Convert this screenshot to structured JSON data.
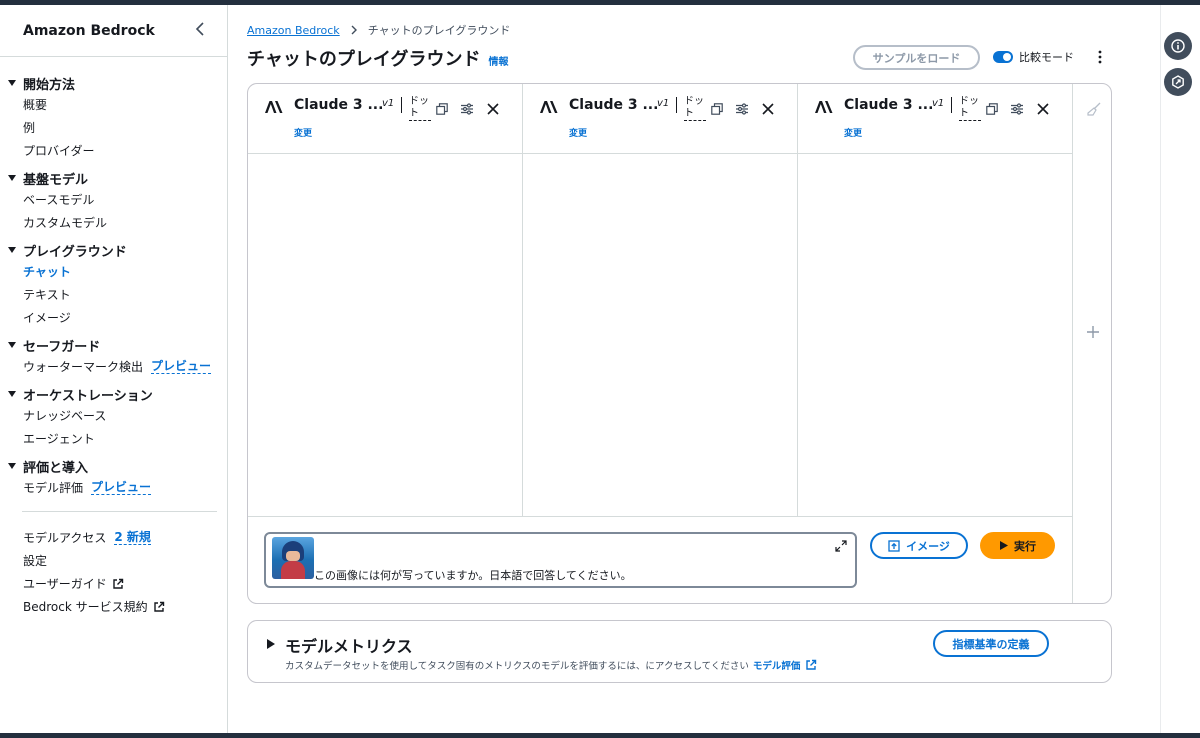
{
  "sidebar": {
    "title": "Amazon Bedrock",
    "sections": [
      {
        "title": "開始方法",
        "items": [
          "概要",
          "例",
          "プロバイダー"
        ]
      },
      {
        "title": "基盤モデル",
        "items": [
          "ベースモデル",
          "カスタムモデル"
        ]
      },
      {
        "title": "プレイグラウンド",
        "items": [
          "チャット",
          "テキスト",
          "イメージ"
        ]
      },
      {
        "title": "セーフガード",
        "items": [
          "ウォーターマーク検出"
        ],
        "badge": "プレビュー"
      },
      {
        "title": "オーケストレーション",
        "items": [
          "ナレッジベース",
          "エージェント"
        ]
      },
      {
        "title": "評価と導入",
        "items": [
          "モデル評価"
        ],
        "badge": "プレビュー"
      }
    ],
    "footer": {
      "model_access": "モデルアクセス",
      "model_access_badge": "2 新規",
      "settings": "設定",
      "user_guide": "ユーザーガイド",
      "terms": "Bedrock サービス規約"
    }
  },
  "breadcrumb": {
    "root": "Amazon Bedrock",
    "current": "チャットのプレイグラウンド"
  },
  "header": {
    "title": "チャットのプレイグラウンド",
    "info": "情報",
    "load_sample": "サンプルをロード",
    "compare_mode": "比較モード"
  },
  "models": [
    {
      "name": "Claude 3 ...",
      "version": "v1",
      "dot": "ドット",
      "change": "変更"
    },
    {
      "name": "Claude 3 ...",
      "version": "v1",
      "dot": "ドット",
      "change": "変更"
    },
    {
      "name": "Claude 3 ...",
      "version": "v1",
      "dot": "ドット",
      "change": "変更"
    }
  ],
  "prompt": {
    "text": "この画像には何が写っていますか。日本語で回答してください。",
    "image_button": "イメージ",
    "run_button": "実行"
  },
  "metrics": {
    "title": "モデルメトリクス",
    "description": "カスタムデータセットを使用してタスク固有のメトリクスのモデルを評価するには、にアクセスしてください",
    "link": "モデル評価",
    "button": "指標基準の定義"
  },
  "colors": {
    "accent": "#0972d3",
    "run": "#ff9900",
    "border": "#c6c6cd",
    "topbar": "#232f3e"
  }
}
